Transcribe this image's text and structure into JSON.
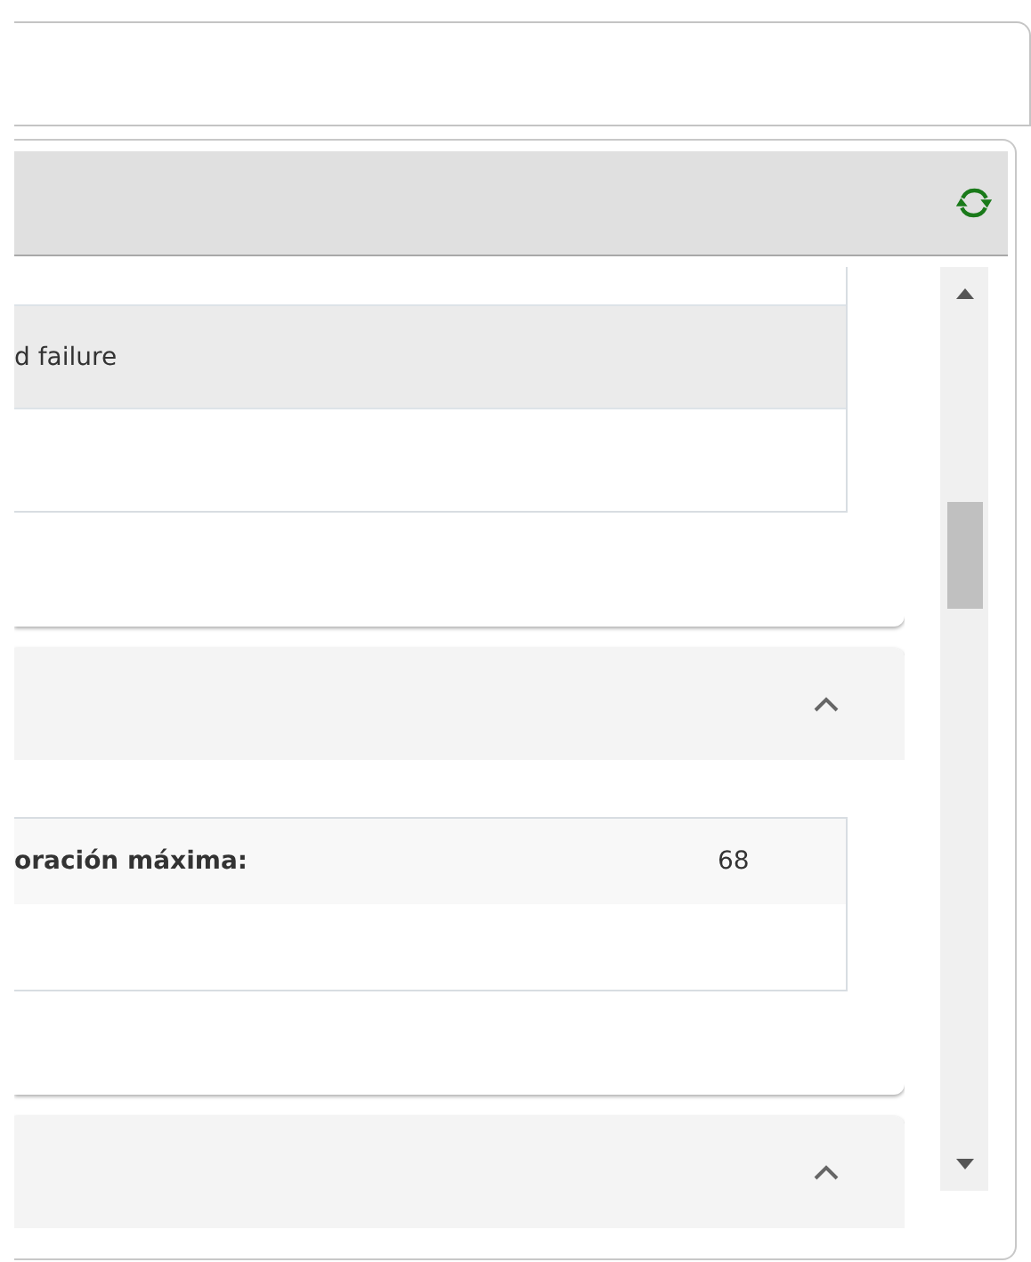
{
  "sections": [
    {
      "kind": "list",
      "rows": [
        {
          "text": "d failure"
        }
      ]
    },
    {
      "kind": "collapsible",
      "expanded": true,
      "rows": [
        {
          "label": "oración máxima:",
          "value": "68"
        }
      ]
    },
    {
      "kind": "collapsible",
      "expanded": true
    }
  ]
}
